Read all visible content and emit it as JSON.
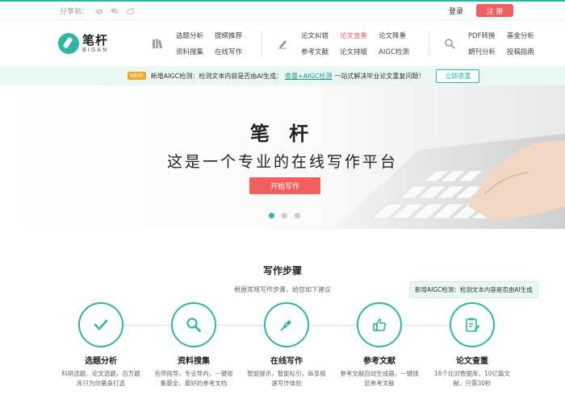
{
  "topbar": {
    "share_label": "分享到：",
    "login": "登录",
    "register": "注 册"
  },
  "brand": {
    "name_cn": "笔杆",
    "name_en": "BIGAN",
    "color": "#2bb7a4"
  },
  "nav": {
    "groups": [
      {
        "icon": "books-icon",
        "links": [
          "选题分析",
          "提纲推荐",
          "资料搜集",
          "在线写作"
        ]
      },
      {
        "icon": "pen-icon",
        "links": [
          "论文纠错",
          "论文查重",
          "论文降重",
          "参考文献",
          "论文排版",
          "AIGC检测"
        ],
        "active": "论文查重"
      },
      {
        "icon": "search-icon",
        "links": [
          "PDF转换",
          "基金分析",
          "期刊分析",
          "投稿指南"
        ]
      }
    ]
  },
  "notice": {
    "badge": "NEW",
    "text_before": "新增AIGC检测：检测文本内容是否由AI生成：",
    "highlight": "查重+AIGC检测",
    "text_after": "一站式解决毕业论文重复问题！",
    "button": "立即查重"
  },
  "hero": {
    "title": "笔 杆",
    "subtitle": "这是一个专业的在线写作平台",
    "cta": "开始写作",
    "slides": 3,
    "active_slide": 1
  },
  "steps": {
    "title": "写作步骤",
    "subtitle": "根据常规写作步骤，给您如下建议",
    "tooltip": "新增AIGC检测：检测文本内容是否由AI生成",
    "items": [
      {
        "name": "选题分析",
        "desc": "科研选题、论文选题，百万题库只为你量身打造",
        "icon": "check-icon"
      },
      {
        "name": "资料搜集",
        "desc": "名师指导，专业导向，一键收集最全、最好的参考文档",
        "icon": "magnifier-icon"
      },
      {
        "name": "在线写作",
        "desc": "智能提示，智能标引，纵享极速写作体验",
        "icon": "pen-nib-icon"
      },
      {
        "name": "参考文献",
        "desc": "参考文献自动生成器，一键规范参考文献",
        "icon": "thumbs-up-icon"
      },
      {
        "name": "论文查重",
        "desc": "16个比对数据库，10亿篇文献，只需30秒",
        "icon": "clipboard-edit-icon"
      }
    ]
  },
  "colors": {
    "accent": "#2bb7a4",
    "cta": "#f25d5d",
    "notice_bg": "#e9f8f3"
  }
}
